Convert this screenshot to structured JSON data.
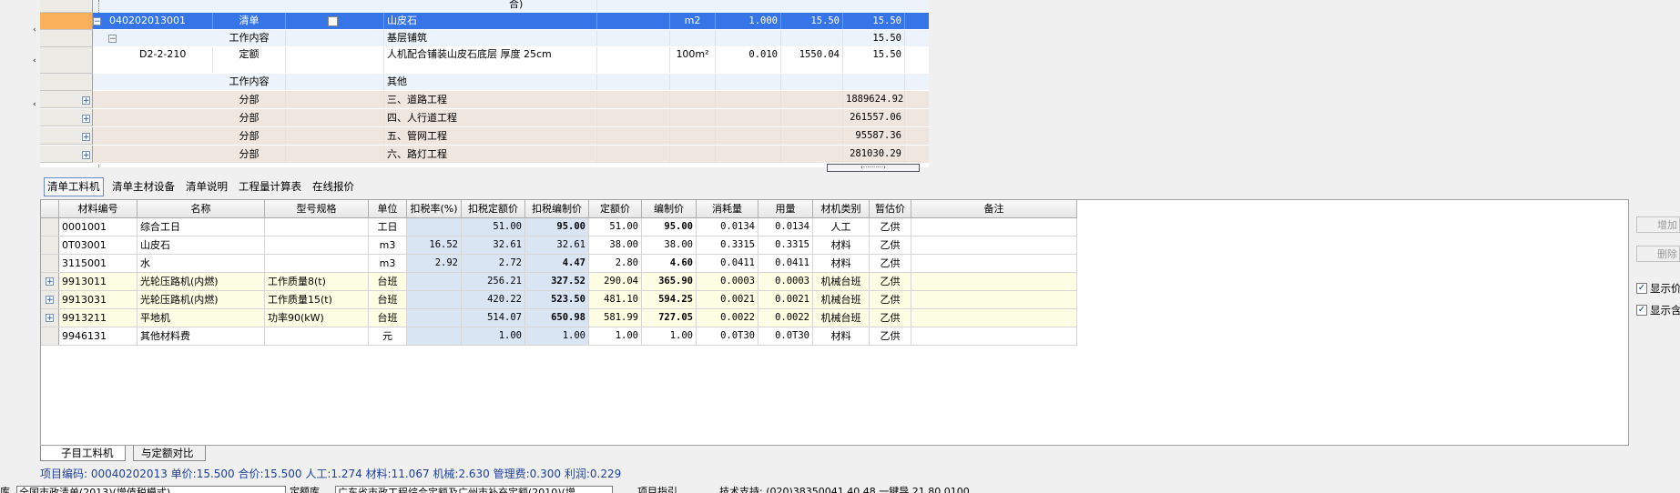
{
  "upper_grid": {
    "top_partial_text": "合)",
    "rows": [
      {
        "code": "040202013001",
        "type": "清单",
        "checkbox": "",
        "name": "山皮石",
        "unit": "m2",
        "qty": "1.000",
        "price": "15.50",
        "total": "15.50",
        "style": "selected",
        "expander": "−"
      },
      {
        "code": "",
        "type": "工作内容",
        "name": "基层铺筑",
        "unit": "",
        "qty": "",
        "price": "",
        "total": "15.50",
        "style": "light",
        "expander": "−"
      },
      {
        "code": "D2-2-210",
        "type": "定额",
        "name": "人机配合铺装山皮石底层 厚度 25cm",
        "unit": "100m²",
        "qty": "0.010",
        "price": "1550.04",
        "total": "15.50",
        "style": "white"
      },
      {
        "code": "",
        "type": "工作内容",
        "name": "其他",
        "unit": "",
        "qty": "",
        "price": "",
        "total": "",
        "style": "light"
      },
      {
        "code": "",
        "type": "分部",
        "name": "三、道路工程",
        "total": "1889624.92",
        "style": "tan",
        "expander": "+"
      },
      {
        "code": "",
        "type": "分部",
        "name": "四、人行道工程",
        "total": "261557.06",
        "style": "tan",
        "expander": "+"
      },
      {
        "code": "",
        "type": "分部",
        "name": "五、管网工程",
        "total": "95587.36",
        "style": "tan",
        "expander": "+"
      },
      {
        "code": "",
        "type": "分部",
        "name": "六、路灯工程",
        "total": "281030.29",
        "style": "tan",
        "expander": "+"
      }
    ]
  },
  "tabs": [
    {
      "label": "清单工料机",
      "active": true
    },
    {
      "label": "清单主材设备",
      "active": false
    },
    {
      "label": "清单说明",
      "active": false
    },
    {
      "label": "工程量计算表",
      "active": false
    },
    {
      "label": "在线报价",
      "active": false
    }
  ],
  "material_table": {
    "headers": [
      "材料编号",
      "名称",
      "型号规格",
      "单位",
      "扣税率(%)",
      "扣税定额价",
      "扣税编制价",
      "定额价",
      "编制价",
      "消耗量",
      "用量",
      "材机类别",
      "暂估价",
      "备注"
    ],
    "rows": [
      {
        "code": "0001001",
        "name": "综合工日",
        "spec": "",
        "unit": "工日",
        "rate": "",
        "qty_tax": "51.00",
        "btax": "95.00",
        "qprice": "51.00",
        "bprice": "95.00",
        "consume": "0.0134",
        "usage": "0.0134",
        "category": "人工",
        "provisional": "乙供",
        "note": "",
        "yellow": false,
        "expander": ""
      },
      {
        "code": "0T03001",
        "name": "山皮石",
        "spec": "",
        "unit": "m3",
        "rate": "16.52",
        "qty_tax": "32.61",
        "btax": "32.61",
        "qprice": "38.00",
        "bprice": "38.00",
        "consume": "0.3315",
        "usage": "0.3315",
        "category": "材料",
        "provisional": "乙供",
        "note": "",
        "yellow": false,
        "expander": ""
      },
      {
        "code": "3115001",
        "name": "水",
        "spec": "",
        "unit": "m3",
        "rate": "2.92",
        "qty_tax": "2.72",
        "btax": "4.47",
        "qprice": "2.80",
        "bprice": "4.60",
        "consume": "0.0411",
        "usage": "0.0411",
        "category": "材料",
        "provisional": "乙供",
        "note": "",
        "yellow": false,
        "expander": ""
      },
      {
        "code": "9913011",
        "name": "光轮压路机(内燃)",
        "spec": "工作质量8(t)",
        "unit": "台班",
        "rate": "",
        "qty_tax": "256.21",
        "btax": "327.52",
        "qprice": "290.04",
        "bprice": "365.90",
        "consume": "0.0003",
        "usage": "0.0003",
        "category": "机械台班",
        "provisional": "乙供",
        "note": "",
        "yellow": true,
        "expander": "+"
      },
      {
        "code": "9913031",
        "name": "光轮压路机(内燃)",
        "spec": "工作质量15(t)",
        "unit": "台班",
        "rate": "",
        "qty_tax": "420.22",
        "btax": "523.50",
        "qprice": "481.10",
        "bprice": "594.25",
        "consume": "0.0021",
        "usage": "0.0021",
        "category": "机械台班",
        "provisional": "乙供",
        "note": "",
        "yellow": true,
        "expander": "+"
      },
      {
        "code": "9913211",
        "name": "平地机",
        "spec": "功率90(kW)",
        "unit": "台班",
        "rate": "",
        "qty_tax": "514.07",
        "btax": "650.98",
        "qprice": "581.99",
        "bprice": "727.05",
        "consume": "0.0022",
        "usage": "0.0022",
        "category": "机械台班",
        "provisional": "乙供",
        "note": "",
        "yellow": true,
        "expander": "+"
      },
      {
        "code": "9946131",
        "name": "其他材料费",
        "spec": "",
        "unit": "元",
        "rate": "",
        "qty_tax": "1.00",
        "btax": "1.00",
        "qprice": "1.00",
        "bprice": "1.00",
        "consume": "0.0T30",
        "usage": "0.0T30",
        "category": "材料",
        "provisional": "乙供",
        "note": "",
        "yellow": false,
        "expander": ""
      }
    ]
  },
  "right_panel": {
    "add_button": "增加",
    "delete_button": "删除",
    "check1": "显示价",
    "check2": "显示含"
  },
  "bottom_tabs": [
    "子目工料机",
    "与定额对比"
  ],
  "summary": "项目编码: 00040202013 单价:15.500 合价:15.500 人工:1.274 材料:11.067 机械:2.630 管理费:0.300 利润:0.229",
  "status_bar": {
    "label1": "库",
    "field1": "全国市政清单(2013)(增值税模式)",
    "label2": "定额库",
    "field2": "广东省市政工程综合定额及广州市补充定额(2010)(增",
    "item3": "项目指引",
    "item4": "技术支持: (020)38350041 40 48 一键导 21 80 0100"
  },
  "icons": {
    "collapse": "minus-box-icon",
    "expand": "plus-box-icon",
    "check": "checkmark-icon"
  },
  "colors": {
    "selected_row": "#3675e8",
    "tan_row": "#efe6df",
    "yellow_row": "#fdfde3",
    "tax_columns": "#d9e5f3",
    "summary_text": "#1c3f9c"
  }
}
